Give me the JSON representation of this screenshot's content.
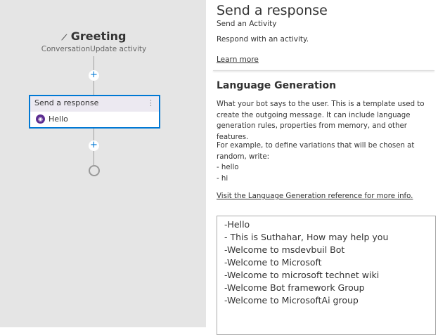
{
  "canvas": {
    "trigger_title": "Greeting",
    "trigger_subtitle": "ConversationUpdate activity",
    "card_title": "Send a response",
    "card_body": "Hello",
    "more_icon": "⋮",
    "add_icon": "+"
  },
  "panel": {
    "title": "Send a response",
    "subtitle": "Send an Activity",
    "description": "Respond with an activity.",
    "learn_more": "Learn more",
    "section_title": "Language Generation",
    "section_desc": "What your bot says to the user. This is a template used to create the outgoing message. It can include language generation rules, properties from memory, and other features.",
    "example_intro": "For example, to define variations that will be chosen at random, write:",
    "example_lines": [
      "- hello",
      "- hi"
    ],
    "reference_link": "Visit the Language Generation reference for more info.",
    "editor_lines": [
      "-Hello",
      "- This is Suthahar, How may help you",
      "-Welcome to msdevbuil Bot",
      "-Welcome to Microsoft",
      "-Welcome to microsoft technet wiki",
      "-Welcome Bot framework Group",
      "-Welcome to MicrosoftAi group"
    ]
  }
}
